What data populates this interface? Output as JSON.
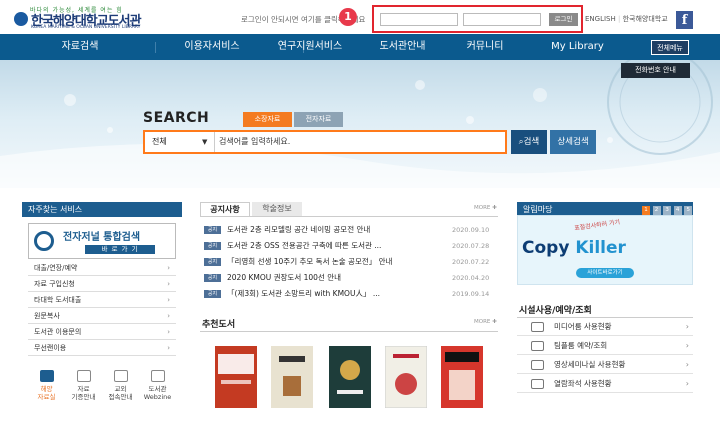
{
  "header": {
    "logo_slogan": "바다의 가능성, 세계를 여는 힘",
    "logo_name": "한국해양대학교도서관",
    "logo_english": "KOREA MARITIME & OCEAN UNIVERSITY LIBRARY",
    "login_message": "로그인이 안되시면 여기를 클릭해주세요",
    "annotation_number": "1",
    "login_button": "로그인",
    "link_english": "ENGLISH",
    "link_university": "한국해양대학교",
    "facebook": "f"
  },
  "nav": {
    "items": [
      "자료검색",
      "이용자서비스",
      "연구지원서비스",
      "도서관안내",
      "커뮤니티",
      "My Library"
    ],
    "all_menu": "전체메뉴"
  },
  "hero": {
    "phone_button": "전화번호 안내",
    "search_title": "SEARCH",
    "tabs": [
      "소장자료",
      "전자자료"
    ],
    "scope_value": "전체",
    "search_placeholder": "검색어를 입력하세요.",
    "search_button": "검색",
    "advanced_button": "상세검색"
  },
  "left": {
    "title": "자주찾는 서비스",
    "ejournal_title": "전자저널 통합검색",
    "ejournal_button": "바 로 가 기",
    "services": [
      "대출/연장/예약",
      "자료 구입신청",
      "타대학 도서대출",
      "원문복사",
      "도서관 이용문의",
      "무선랜이용"
    ],
    "quick_links": [
      {
        "line1": "해양",
        "line2": "자료실",
        "active": true
      },
      {
        "line1": "자료",
        "line2": "기증안내",
        "active": false
      },
      {
        "line1": "교외",
        "line2": "접속안내",
        "active": false
      },
      {
        "line1": "도서관",
        "line2": "Webzine",
        "active": false
      }
    ]
  },
  "center": {
    "tabs": [
      "공지사항",
      "학술정보"
    ],
    "more": "MORE ✚",
    "notice_tag": "공지",
    "notices": [
      {
        "title": "도서관 2층 리모델링 공간 네이밍 공모전 안내",
        "date": "2020.09.10"
      },
      {
        "title": "도서관 2층 OSS 전용공간 구축에 따른 도서관 ...",
        "date": "2020.07.28"
      },
      {
        "title": "「리영희 선생 10주기 추모 독서 논술 공모전」 안내",
        "date": "2020.07.22"
      },
      {
        "title": "2020 KMOU 권장도서 100선 안내",
        "date": "2020.04.20"
      },
      {
        "title": "「(제3회) 도서관 소망트리 with KMOU人」 ...",
        "date": "2019.09.14"
      }
    ],
    "recommend_title": "추천도서",
    "recommend_more": "MORE ✚",
    "books": [
      {
        "title": "INSTA BRAIN",
        "color": "#c43a22"
      },
      {
        "title": "철학",
        "color": "#e8e2d0"
      },
      {
        "title": "지구",
        "color": "#1e3d3a"
      },
      {
        "title": "사람",
        "color": "#f1efe6"
      },
      {
        "title": "YOUTUBERS",
        "color": "#d6362c"
      }
    ]
  },
  "right": {
    "title": "알림마당",
    "pager": [
      "1",
      "2",
      "3",
      "4",
      "5"
    ],
    "banner_note": "표절검사하러 가기",
    "banner_copy": "Copy",
    "banner_killer": "Killer",
    "banner_button": "사이트바로가기",
    "facility_title": "시설사용/예약/조회",
    "facilities": [
      "미디어룸 사용현황",
      "팀플룸 예약/조회",
      "영상세미나실 사용현황",
      "열람좌석 사용현황"
    ]
  }
}
